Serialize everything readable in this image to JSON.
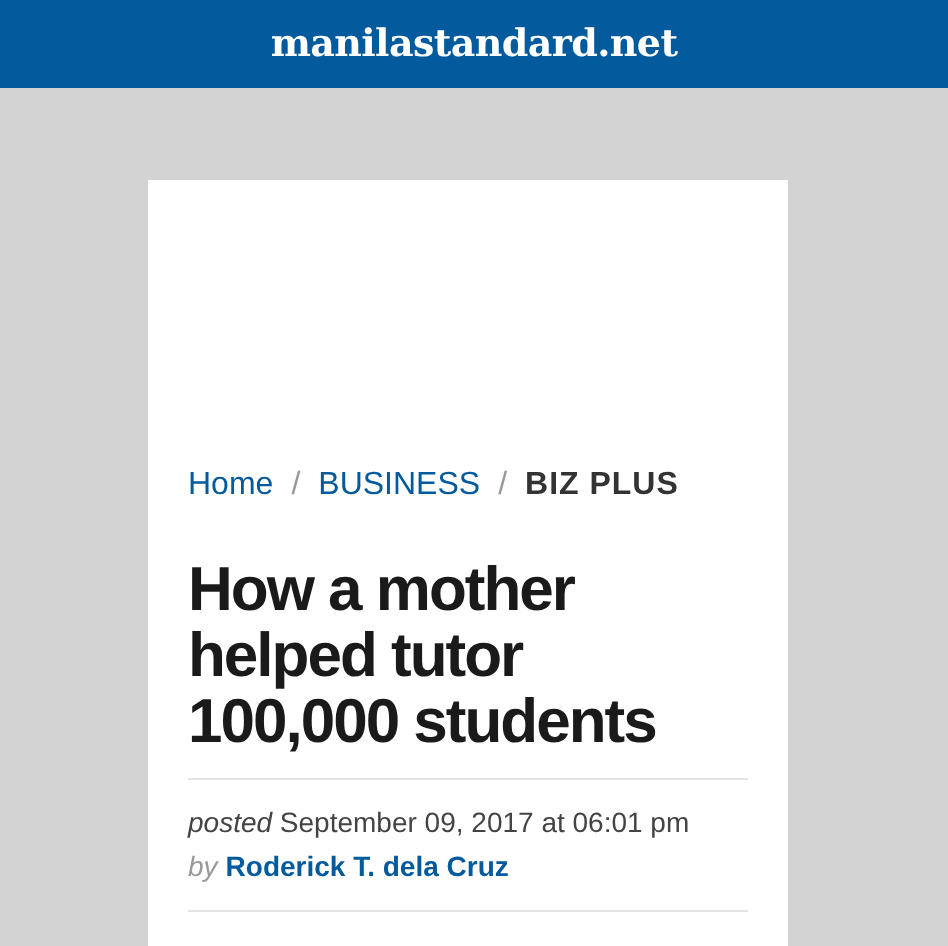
{
  "header": {
    "site_name": "manilastandard.net"
  },
  "breadcrumb": [
    {
      "label": "Home",
      "kind": "link"
    },
    {
      "label": "/",
      "kind": "separator"
    },
    {
      "label": "BUSINESS",
      "kind": "link"
    },
    {
      "label": "/",
      "kind": "separator"
    },
    {
      "label": "BIZ PLUS",
      "kind": "current"
    }
  ],
  "article": {
    "title": "How a mother helped tutor 100,000 students",
    "posted": "*posted* September 09, 2017 at 06:01 pm",
    "by_label": "by",
    "author": "Roderick T. dela Cruz"
  }
}
